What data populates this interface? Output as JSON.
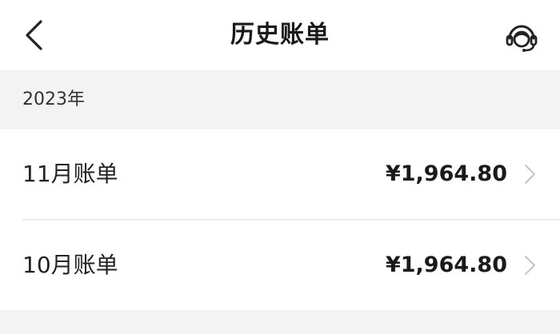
{
  "header": {
    "title": "历史账单",
    "back_icon": "chevron-left-icon",
    "support_icon": "customer-service-headset-icon"
  },
  "sections": [
    {
      "year": "2023年",
      "bills": [
        {
          "label": "11月账单",
          "amount": "¥1,964.80"
        },
        {
          "label": "10月账单",
          "amount": "¥1,964.80"
        }
      ]
    }
  ],
  "colors": {
    "page_background": "#f3f3f3",
    "card_background": "#ffffff",
    "text_primary": "#222222",
    "chevron": "#c4c4c4"
  }
}
